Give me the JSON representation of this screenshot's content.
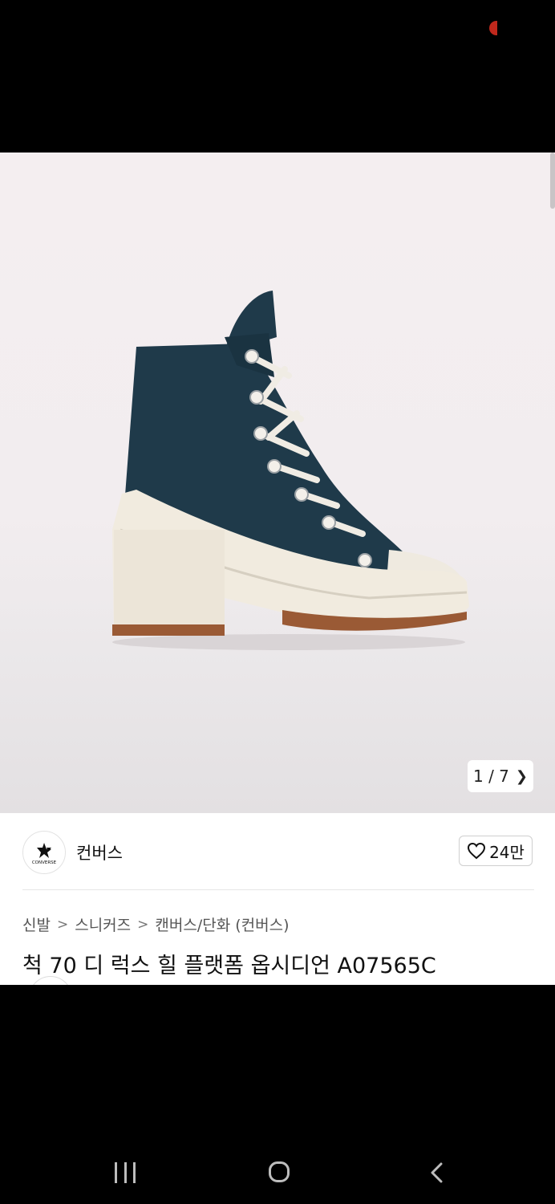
{
  "status_bar": {
    "indicator_color": "#c0281c"
  },
  "gallery": {
    "counter": "1 / 7",
    "product_image": "black high-top platform heel sneaker"
  },
  "brand": {
    "name": "컨버스",
    "logo_text": "CONVERSE"
  },
  "like": {
    "count": "24만",
    "icon": "heart-icon"
  },
  "breadcrumb": {
    "items": [
      "신발",
      "스니커즈",
      "캔버스/단화 (컨버스)"
    ],
    "separator": ">"
  },
  "product": {
    "title": "척 70 디 럭스 힐 플랫폼 옵시디언 A07565C"
  },
  "nav_bar": {
    "recent_icon": "recent-apps-icon",
    "home_icon": "home-icon",
    "back_icon": "back-icon"
  }
}
